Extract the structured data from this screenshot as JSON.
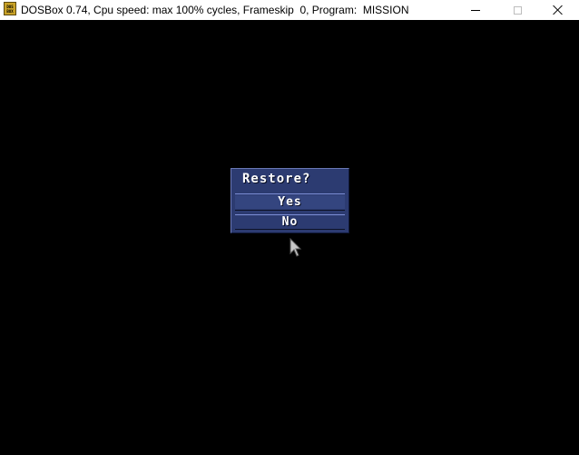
{
  "window": {
    "title": "DOSBox 0.74, Cpu speed: max 100% cycles, Frameskip  0, Program:  MISSION",
    "icon_label_top": "DOS",
    "icon_label_bottom": "BOX"
  },
  "dialog": {
    "title": "Restore?",
    "options": [
      {
        "label": "Yes"
      },
      {
        "label": "No"
      }
    ]
  },
  "colors": {
    "dialog_background": "#2c3b71",
    "divider_highlight": "#7d8fd6",
    "text": "#ffffff",
    "screen_background": "#000000"
  },
  "icons": {
    "app": "dosbox-icon",
    "minimize": "minimize-icon",
    "maximize": "maximize-icon",
    "close": "close-icon",
    "cursor": "mouse-cursor-icon"
  }
}
